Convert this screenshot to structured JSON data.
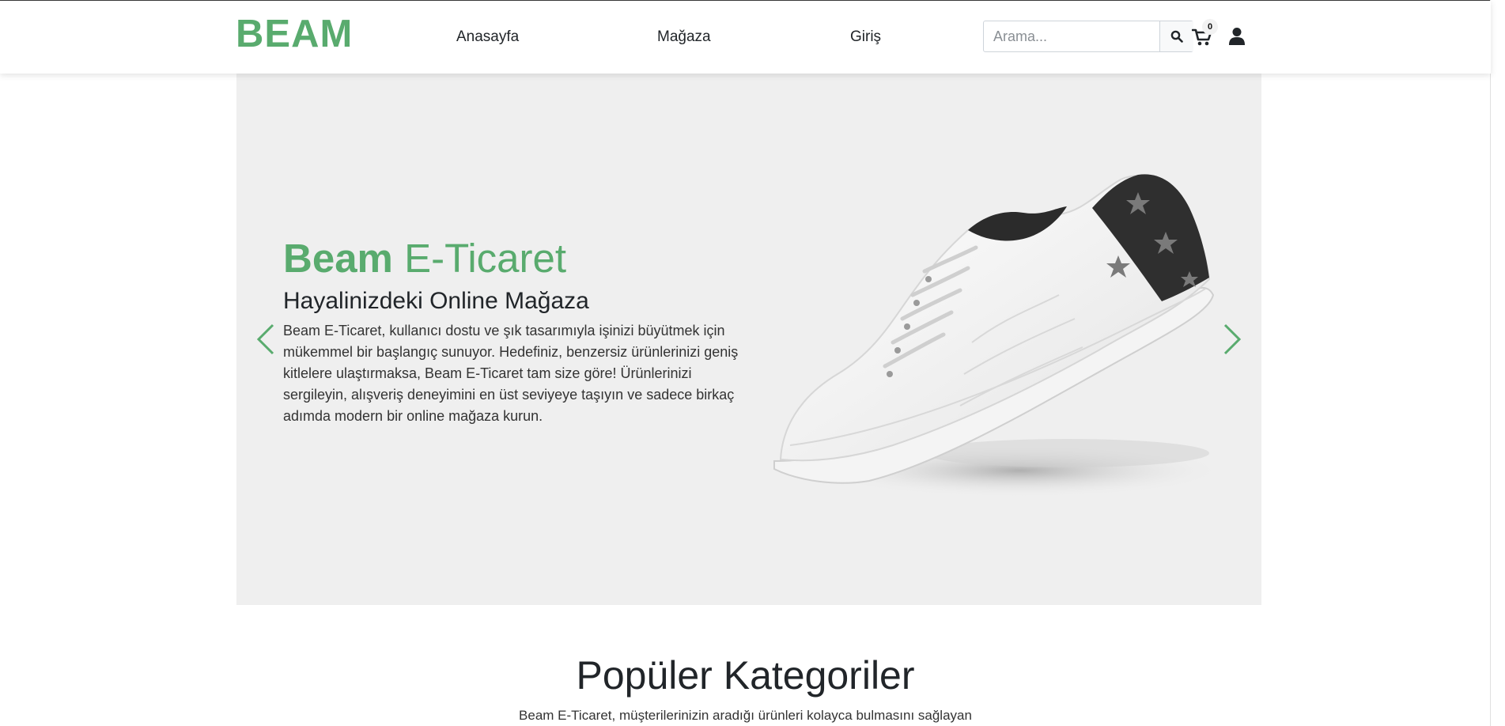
{
  "brand": {
    "name": "BEAM",
    "color": "#59ab6e"
  },
  "nav": {
    "items": [
      {
        "label": "Anasayfa"
      },
      {
        "label": "Mağaza"
      },
      {
        "label": "Giriş"
      }
    ]
  },
  "search": {
    "placeholder": "Arama...",
    "value": "",
    "icon": "search-icon"
  },
  "cart": {
    "count": "0",
    "icon": "cart-icon"
  },
  "user": {
    "icon": "user-icon"
  },
  "hero": {
    "title_bold": "Beam",
    "title_light": "E-Ticaret",
    "subtitle": "Hayalinizdeki Online Mağaza",
    "text": "Beam E-Ticaret, kullanıcı dostu ve şık tasarımıyla işinizi büyütmek için mükemmel bir başlangıç sunuyor. Hedefiniz, benzersiz ürünlerinizi geniş kitlelere ulaştırmaksa, Beam E-Ticaret tam size göre! Ürünlerinizi sergileyin, alışveriş deneyimini en üst seviyeye taşıyın ve sadece birkaç adımda modern bir online mağaza kurun.",
    "prev_icon": "chevron-left-icon",
    "next_icon": "chevron-right-icon",
    "image": "sneaker-image"
  },
  "categories": {
    "title": "Popüler Kategoriler",
    "description": "Beam E-Ticaret, müşterilerinizin aradığı ürünleri kolayca bulmasını sağlayan"
  }
}
